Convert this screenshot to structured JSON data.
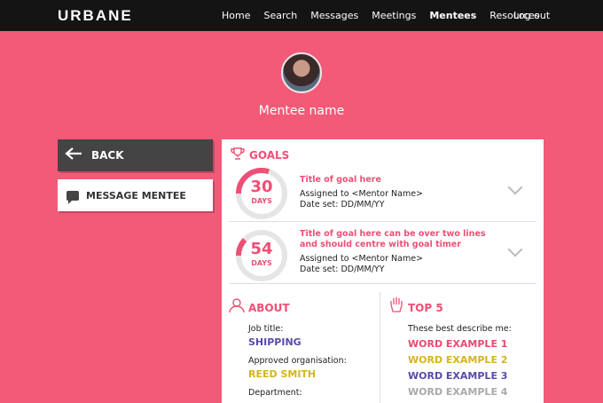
{
  "nav": {
    "brand": "URBANE",
    "items": [
      "Home",
      "Search",
      "Messages",
      "Meetings",
      "Mentees",
      "Resources"
    ],
    "active": "Mentees",
    "logout": "Log out"
  },
  "mentee": {
    "name": "Mentee name"
  },
  "buttons": {
    "back": "BACK",
    "message": "MESSAGE MENTEE"
  },
  "goals": {
    "title": "GOALS",
    "items": [
      {
        "days": "30",
        "days_label": "DAYS",
        "title": "Title of goal here",
        "assigned": "Assigned to <Mentor Name>",
        "date": "Date set: DD/MM/YY",
        "progress": 0.3
      },
      {
        "days": "54",
        "days_label": "DAYS",
        "title": "Title of goal here can be over two lines and should centre with goal timer",
        "assigned": "Assigned to <Mentor Name>",
        "date": "Date set: DD/MM/YY",
        "progress": 0.12
      }
    ]
  },
  "about": {
    "title": "ABOUT",
    "job_label": "Job title:",
    "job_value": "SHIPPING",
    "org_label": "Approved organisation:",
    "org_value": "REED SMITH",
    "dept_label": "Department:"
  },
  "top5": {
    "title": "TOP 5",
    "intro": "These best describe me:",
    "words": [
      {
        "text": "WORD EXAMPLE 1",
        "color": "#e94a70"
      },
      {
        "text": "WORD EXAMPLE 2",
        "color": "#d4b51b"
      },
      {
        "text": "WORD EXAMPLE 3",
        "color": "#5a4aa8"
      },
      {
        "text": "WORD EXAMPLE 4",
        "color": "#a9a9a9"
      }
    ]
  },
  "colors": {
    "accent": "#ee4f75",
    "background": "#f25a78",
    "topbar": "#141414",
    "job": "#5a4aa8",
    "org": "#d4b51b"
  }
}
